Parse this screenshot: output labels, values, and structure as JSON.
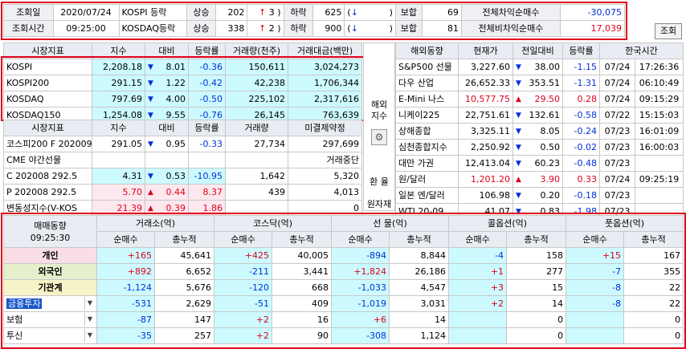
{
  "status": {
    "label_date": "조회일",
    "date": "2020/07/24",
    "label_time": "조회시간",
    "time": "09:25:00",
    "rows": [
      {
        "market": "KOSPI 등락",
        "up_label": "상승",
        "up": "202",
        "limit_up": "3",
        "down_label": "하락",
        "down": "625",
        "flat_label": "보합",
        "flat": "69",
        "arb_label": "전체차익순매수",
        "arb": "-30,075"
      },
      {
        "market": "KOSDAQ등락",
        "up_label": "상승",
        "up": "338",
        "limit_up": "2",
        "down_label": "하락",
        "down": "900",
        "flat_label": "보합",
        "flat": "81",
        "arb_label": "전체비차익순매수",
        "arb": "17,039"
      }
    ],
    "up_arrow": "↑",
    "down_arrow": "↓",
    "query_button": "조회"
  },
  "index_table": {
    "headers": [
      "시장지표",
      "지수",
      "대비",
      "등락률",
      "거래량(천주)",
      "거래대금(백만)"
    ],
    "rows": [
      {
        "name": "KOSPI",
        "value": "2,208.18",
        "dir": "down",
        "change": "8.01",
        "rate": "-0.36",
        "volume": "150,611",
        "amount": "3,024,273"
      },
      {
        "name": "KOSPI200",
        "value": "291.15",
        "dir": "down",
        "change": "1.22",
        "rate": "-0.42",
        "volume": "42,238",
        "amount": "1,706,344"
      },
      {
        "name": "KOSDAQ",
        "value": "797.69",
        "dir": "down",
        "change": "4.00",
        "rate": "-0.50",
        "volume": "225,102",
        "amount": "2,317,616"
      },
      {
        "name": "KOSDAQ150",
        "value": "1,254.08",
        "dir": "down",
        "change": "9.55",
        "rate": "-0.76",
        "volume": "26,145",
        "amount": "763,639"
      }
    ]
  },
  "futures_table": {
    "headers": [
      "시장지표",
      "지수",
      "대비",
      "등락률",
      "거래량",
      "미결제약정"
    ],
    "rows": [
      {
        "name": "코스피200 F 202009",
        "value": "291.05",
        "dir": "down",
        "change": "0.95",
        "rate": "-0.33",
        "volume": "27,734",
        "oi": "297,699"
      },
      {
        "name": "CME 야간선물",
        "value": "",
        "dir": "",
        "change": "",
        "rate": "",
        "volume": "",
        "oi": "거래중단"
      },
      {
        "name": "C 202008 292.5",
        "value": "4.31",
        "dir": "down",
        "change": "0.53",
        "rate": "-10.95",
        "volume": "1,642",
        "oi": "5,320"
      },
      {
        "name": "P 202008 292.5",
        "value": "5.70",
        "dir": "up",
        "change": "0.44",
        "rate": "8.37",
        "volume": "439",
        "oi": "4,013"
      },
      {
        "name": "변동성지수(V-KOS",
        "value": "21.39",
        "dir": "up",
        "change": "0.39",
        "rate": "1.86",
        "volume": "",
        "oi": "0"
      }
    ]
  },
  "side_labels": {
    "overseas": "해외\n지수",
    "fx": "환 율",
    "commodity": "원자재"
  },
  "world_table": {
    "headers": [
      "해외동향",
      "현재가",
      "전일대비",
      "등락률",
      "한국시간"
    ],
    "rows": [
      {
        "name": "S&P500 선물",
        "value": "3,227.60",
        "dir": "down",
        "change": "38.00",
        "rate": "-1.15",
        "date": "07/24",
        "time": "17:26:36"
      },
      {
        "name": "다우 산업",
        "value": "26,652.33",
        "dir": "down",
        "change": "353.51",
        "rate": "-1.31",
        "date": "07/24",
        "time": "06:10:49"
      },
      {
        "name": "E-Mini 나스",
        "value": "10,577.75",
        "dir": "up",
        "change": "29.50",
        "rate": "0.28",
        "date": "07/24",
        "time": "09:15:29"
      },
      {
        "name": "니케이225",
        "value": "22,751.61",
        "dir": "down",
        "change": "132.61",
        "rate": "-0.58",
        "date": "07/22",
        "time": "15:15:03"
      },
      {
        "name": "상해종합",
        "value": "3,325.11",
        "dir": "down",
        "change": "8.05",
        "rate": "-0.24",
        "date": "07/23",
        "time": "16:01:09"
      },
      {
        "name": "심천종합지수",
        "value": "2,250.92",
        "dir": "down",
        "change": "0.50",
        "rate": "-0.02",
        "date": "07/23",
        "time": "16:00:03"
      },
      {
        "name": "대만 가권",
        "value": "12,413.04",
        "dir": "down",
        "change": "60.23",
        "rate": "-0.48",
        "date": "07/23",
        "time": ""
      },
      {
        "name": "원/달러",
        "value": "1,201.20",
        "dir": "up",
        "change": "3.90",
        "rate": "0.33",
        "date": "07/24",
        "time": "09:25:19"
      },
      {
        "name": "일본 엔/달러",
        "value": "106.98",
        "dir": "down",
        "change": "0.20",
        "rate": "-0.18",
        "date": "07/23",
        "time": ""
      },
      {
        "name": "WTI 20-09",
        "value": "41.07",
        "dir": "down",
        "change": "0.83",
        "rate": "-1.98",
        "date": "07/23",
        "time": ""
      }
    ]
  },
  "investor": {
    "title": "매매동향",
    "time": "09:25:30",
    "groups": [
      "거래소(억)",
      "코스닥(억)",
      "선 물(억)",
      "콜옵션(억)",
      "풋옵션(억)"
    ],
    "sub": [
      "순매수",
      "총누적"
    ],
    "rows": [
      {
        "name": "개인",
        "style": "pink",
        "vals": [
          "+165",
          "45,641",
          "+425",
          "40,005",
          "-894",
          "8,844",
          "-4",
          "158",
          "+15",
          "167"
        ]
      },
      {
        "name": "외국인",
        "style": "green",
        "vals": [
          "+892",
          "6,652",
          "-211",
          "3,441",
          "+1,824",
          "26,186",
          "+1",
          "277",
          "-7",
          "355"
        ]
      },
      {
        "name": "기관계",
        "style": "yellow",
        "vals": [
          "-1,124",
          "5,676",
          "-120",
          "668",
          "-1,033",
          "4,547",
          "+3",
          "15",
          "-8",
          "22"
        ]
      },
      {
        "name": "금융투자",
        "style": "select",
        "vals": [
          "-531",
          "2,629",
          "-51",
          "409",
          "-1,019",
          "3,031",
          "+2",
          "14",
          "-8",
          "22"
        ]
      },
      {
        "name": "보험",
        "style": "plain",
        "vals": [
          "-87",
          "147",
          "+2",
          "16",
          "+6",
          "14",
          "",
          "0",
          "",
          "0"
        ]
      },
      {
        "name": "투신",
        "style": "plain",
        "vals": [
          "-35",
          "257",
          "+2",
          "90",
          "-308",
          "1,124",
          "",
          "0",
          "",
          "0"
        ]
      }
    ]
  },
  "icons": {
    "down": "▼",
    "up": "▲",
    "gear": "⚙",
    "chevron": "▼"
  },
  "colors": {
    "up": "#e0001b",
    "down": "#0030d8",
    "highlight": "#ccfaff",
    "outline": "#e0001b"
  }
}
